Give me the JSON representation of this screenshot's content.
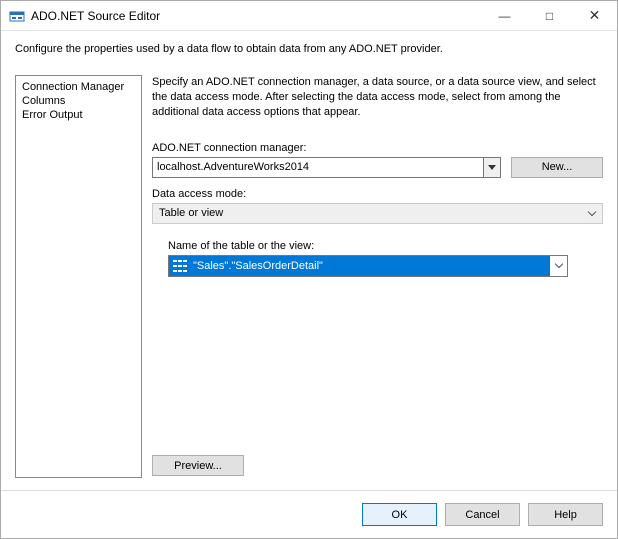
{
  "window": {
    "title": "ADO.NET Source Editor"
  },
  "subheader": "Configure the properties used by a data flow to obtain data from any ADO.NET provider.",
  "sidebar": {
    "items": [
      {
        "label": "Connection Manager"
      },
      {
        "label": "Columns"
      },
      {
        "label": "Error Output"
      }
    ]
  },
  "main": {
    "intro": "Specify an ADO.NET connection manager, a data source, or a data source view, and select the data access mode. After selecting the data access mode, select from among the additional data access options that appear.",
    "conn_label": "ADO.NET connection manager:",
    "conn_value": "localhost.AdventureWorks2014",
    "new_label": "New...",
    "mode_label": "Data access mode:",
    "mode_value": "Table or view",
    "table_label": "Name of the table or the view:",
    "table_value": "\"Sales\".\"SalesOrderDetail\"",
    "preview_label": "Preview..."
  },
  "footer": {
    "ok": "OK",
    "cancel": "Cancel",
    "help": "Help"
  }
}
